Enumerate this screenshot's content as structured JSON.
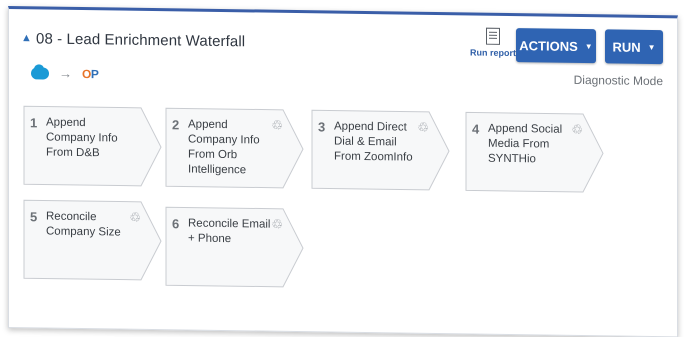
{
  "header": {
    "title": "08 - Lead Enrichment Waterfall",
    "diagnostic_mode": "Diagnostic Mode",
    "run_report_label": "Run report",
    "actions_label": "ACTIONS",
    "run_label": "RUN",
    "flow": {
      "source_icon": "salesforce-cloud-icon",
      "arrow": "→",
      "target_logo_o": "O",
      "target_logo_p": "P"
    }
  },
  "steps": [
    {
      "num": "1",
      "label": "Append Company Info From D&B",
      "recycle": ""
    },
    {
      "num": "2",
      "label": "Append Company Info From Orb Intelligence",
      "recycle": "♲"
    },
    {
      "num": "3",
      "label": "Append Direct Dial & Email From ZoomInfo",
      "recycle": "♲"
    },
    {
      "num": "4",
      "label": "Append Social Media From SYNTHio",
      "recycle": "♲"
    },
    {
      "num": "5",
      "label": "Reconcile Company Size",
      "recycle": "♲"
    },
    {
      "num": "6",
      "label": "Reconcile Email + Phone",
      "recycle": "♲"
    }
  ],
  "colors": {
    "primary_button": "#2f64b3",
    "top_border": "#3a5ea8",
    "orange": "#e8742a"
  }
}
